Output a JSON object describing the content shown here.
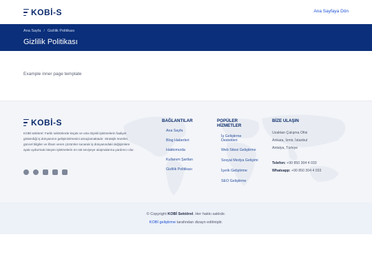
{
  "header": {
    "logo_text": "KOBİ-S",
    "home_link": "Ana Sayfaya Dön"
  },
  "banner": {
    "breadcrumb": [
      "Ana Sayfa",
      "Gizlilik Politikası"
    ],
    "breadcrumb_separator": "/",
    "title": "Gizlilik Politikası"
  },
  "main": {
    "text": "Example inner page template"
  },
  "footer": {
    "logo_text": "KOBİ-S",
    "description": "KOBİ sektörel: Farklı sektörlerde küçük ve orta ölçekli işletmelerin faaliyet gösterdiği iş dünyasının gelişiminlmesini amaçlamaktadır. Stratejik öneriler, güncel bilgiler ve ilham veren çözümler sunarak iş dünyasındaki değişimlere ayak uydurmak isteyen işletmelerin en üst seviyeye ulaşmalarına yardımcı olur.",
    "social_icons": [
      "facebook-icon",
      "pinterest-icon",
      "instagram-icon",
      "linkedin-icon",
      "youtube-icon"
    ],
    "links": {
      "title": "BAĞLANTILAR",
      "items": [
        "Ana Sayfa",
        "Blog Haberleri",
        "Hakkımızda",
        "Kullanım Şartları",
        "Gizlilik Politikası"
      ]
    },
    "services": {
      "title_line1": "POPÜLER",
      "title_line2": "HİZMETLER",
      "items": [
        "İş Geliştirme Destekleri",
        "Web Sitesi Geliştirme",
        "Sosyal Medya Gelişimi",
        "İçerik Geliştirme",
        "SEO Geliştirme"
      ]
    },
    "contact": {
      "title": "BİZE ULAŞIN",
      "address_line1": "Uzaktan Çalışma Ofisi",
      "address_line2": "Ankara, İzmir, İstanbul",
      "address_line3": "Antalya, Türkiye",
      "phone_label": "Telefon:",
      "phone": "+90 850 304 4 033",
      "whatsapp_label": "Whatsapp:",
      "whatsapp": "+90 850 304 4 033"
    }
  },
  "bottom": {
    "copyright_prefix": "© Copyright",
    "brand": "KOBİ Sektörel",
    "copyright_suffix": ". Her hakkı saklıdır.",
    "credit_link": "KOBİ geliştirme",
    "credit_suffix": "tarafından dizayn edilmiştir."
  },
  "colors": {
    "brand_navy": "#0b2a6b",
    "banner_blue": "#0b2f7a",
    "link_blue": "#1a4fd6"
  }
}
